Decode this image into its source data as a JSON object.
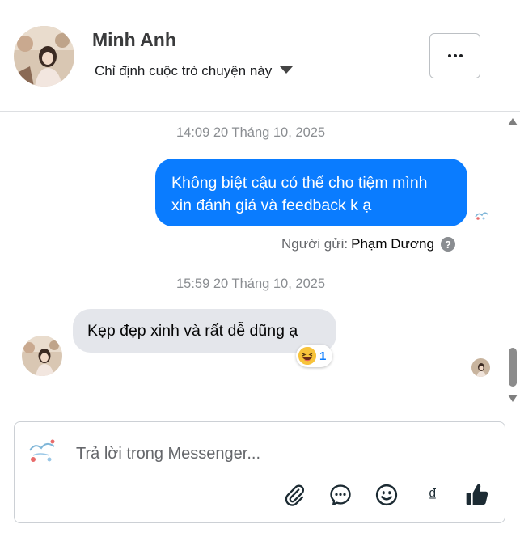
{
  "header": {
    "contact_name": "Minh Anh",
    "assign_label": "Chỉ định cuộc trò chuyện này"
  },
  "conversation": {
    "messages": [
      {
        "timestamp": "14:09 20 Tháng 10, 2025",
        "direction": "outgoing",
        "text": "Không biệt cậu có thể cho tiệm mình xin đánh giá và feedback k ạ",
        "sender_label": "Người gửi:",
        "sender_name": "Phạm Dương"
      },
      {
        "timestamp": "15:59 20 Tháng 10, 2025",
        "direction": "incoming",
        "text": "Kẹp đẹp xinh và rất dễ dũng ạ",
        "reaction_count": "1"
      }
    ]
  },
  "composer": {
    "placeholder": "Trả lời trong Messenger...",
    "currency_symbol": "₫"
  },
  "colors": {
    "outgoing_bubble": "#0a7cff",
    "incoming_bubble": "#e4e6eb",
    "tool_icon": "#1c2b33"
  }
}
